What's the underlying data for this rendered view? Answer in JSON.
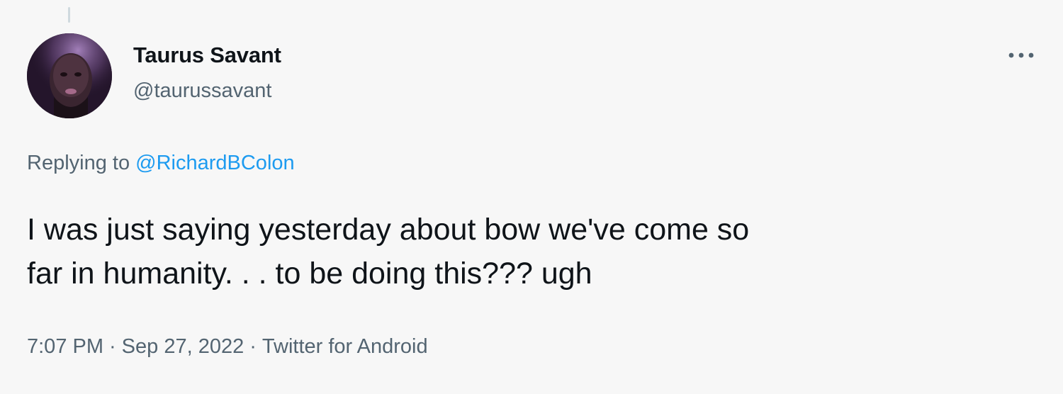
{
  "author": {
    "display_name": "Taurus Savant",
    "handle": "@taurussavant"
  },
  "reply_context": {
    "prefix": "Replying to",
    "mention": "@RichardBColon"
  },
  "tweet": {
    "line1": "I was just saying yesterday about bow we've come so",
    "line2": "far in humanity. . . to be doing this??? ugh"
  },
  "meta": {
    "time": "7:07 PM",
    "separator": "·",
    "date": "Sep 27, 2022",
    "source": "Twitter for Android"
  },
  "icons": {
    "more": "more-horizontal-icon",
    "avatar": "profile-photo"
  },
  "colors": {
    "background": "#f7f7f7",
    "primary_text": "#0f1419",
    "secondary_text": "#536471",
    "link": "#1d9bf0"
  }
}
